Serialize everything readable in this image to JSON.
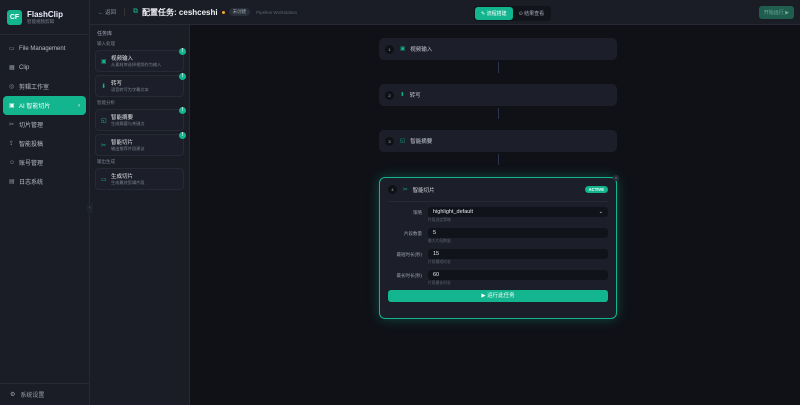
{
  "app": {
    "name": "FlashClip",
    "subtitle": "智能视频剪辑",
    "logo": "CF"
  },
  "nav": [
    {
      "label": "File Management",
      "icon": "folder-icon",
      "glyph": "▭"
    },
    {
      "label": "Clip",
      "icon": "film-icon",
      "glyph": "▦"
    },
    {
      "label": "剪辑工作室",
      "icon": "studio-icon",
      "glyph": "◎"
    },
    {
      "label": "AI 智能切片",
      "icon": "ai-icon",
      "glyph": "▣",
      "active": true
    },
    {
      "label": "切片管理",
      "icon": "scissors-icon",
      "glyph": "✂"
    },
    {
      "label": "智能投稿",
      "icon": "upload-icon",
      "glyph": "⇪"
    },
    {
      "label": "账号管理",
      "icon": "users-icon",
      "glyph": "☺"
    },
    {
      "label": "日志系统",
      "icon": "log-icon",
      "glyph": "▤"
    }
  ],
  "settings": "系统设置",
  "topbar": {
    "back": "← 返回",
    "title": "配置任务: ceshceshi",
    "badge": "未创建",
    "subtitle": "Pipeline Workstation",
    "tabs": [
      "✎ 流程搭建",
      "⊙ 结果查看"
    ],
    "run": "开始运行 ▶"
  },
  "library": {
    "title": "任务库",
    "groups": [
      {
        "label": "输入处理",
        "items": [
          {
            "title": "视频输入",
            "desc": "从素材库选择视频作为输入",
            "glyph": "▣"
          },
          {
            "title": "转写",
            "desc": "语音转写为字幕文本",
            "glyph": "⬇"
          }
        ]
      },
      {
        "label": "智能分析",
        "items": [
          {
            "title": "智能摘要",
            "desc": "生成摘要与关键点",
            "glyph": "◱"
          },
          {
            "title": "智能切片",
            "desc": "输出推荐片段建议",
            "glyph": "✂"
          }
        ]
      },
      {
        "label": "输出生成",
        "items": [
          {
            "title": "生成切片",
            "desc": "生成最终剪辑片段",
            "glyph": "▭"
          }
        ]
      }
    ]
  },
  "pipeline": [
    {
      "num": "1",
      "title": "视频输入",
      "glyph": "▣"
    },
    {
      "num": "2",
      "title": "转写",
      "glyph": "⬇"
    },
    {
      "num": "3",
      "title": "智能摘要",
      "glyph": "◱"
    }
  ],
  "active": {
    "num": "4",
    "title": "智能切片",
    "badge": "ACTIVE",
    "glyph": "✂",
    "fields": [
      {
        "label": "策略",
        "value": "highlight_default",
        "help": "片段选定策略",
        "select": true
      },
      {
        "label": "片段数量",
        "value": "5",
        "help": "最大片段数量"
      },
      {
        "label": "最短时长(秒)",
        "value": "15",
        "help": "片段最短时长"
      },
      {
        "label": "最长时长(秒)",
        "value": "60",
        "help": "片段最长时长"
      }
    ],
    "run": "▶ 运行此任务"
  },
  "colors": {
    "accent": "#13b58e",
    "bg": "#0f1117",
    "panel": "#1a1d26"
  }
}
